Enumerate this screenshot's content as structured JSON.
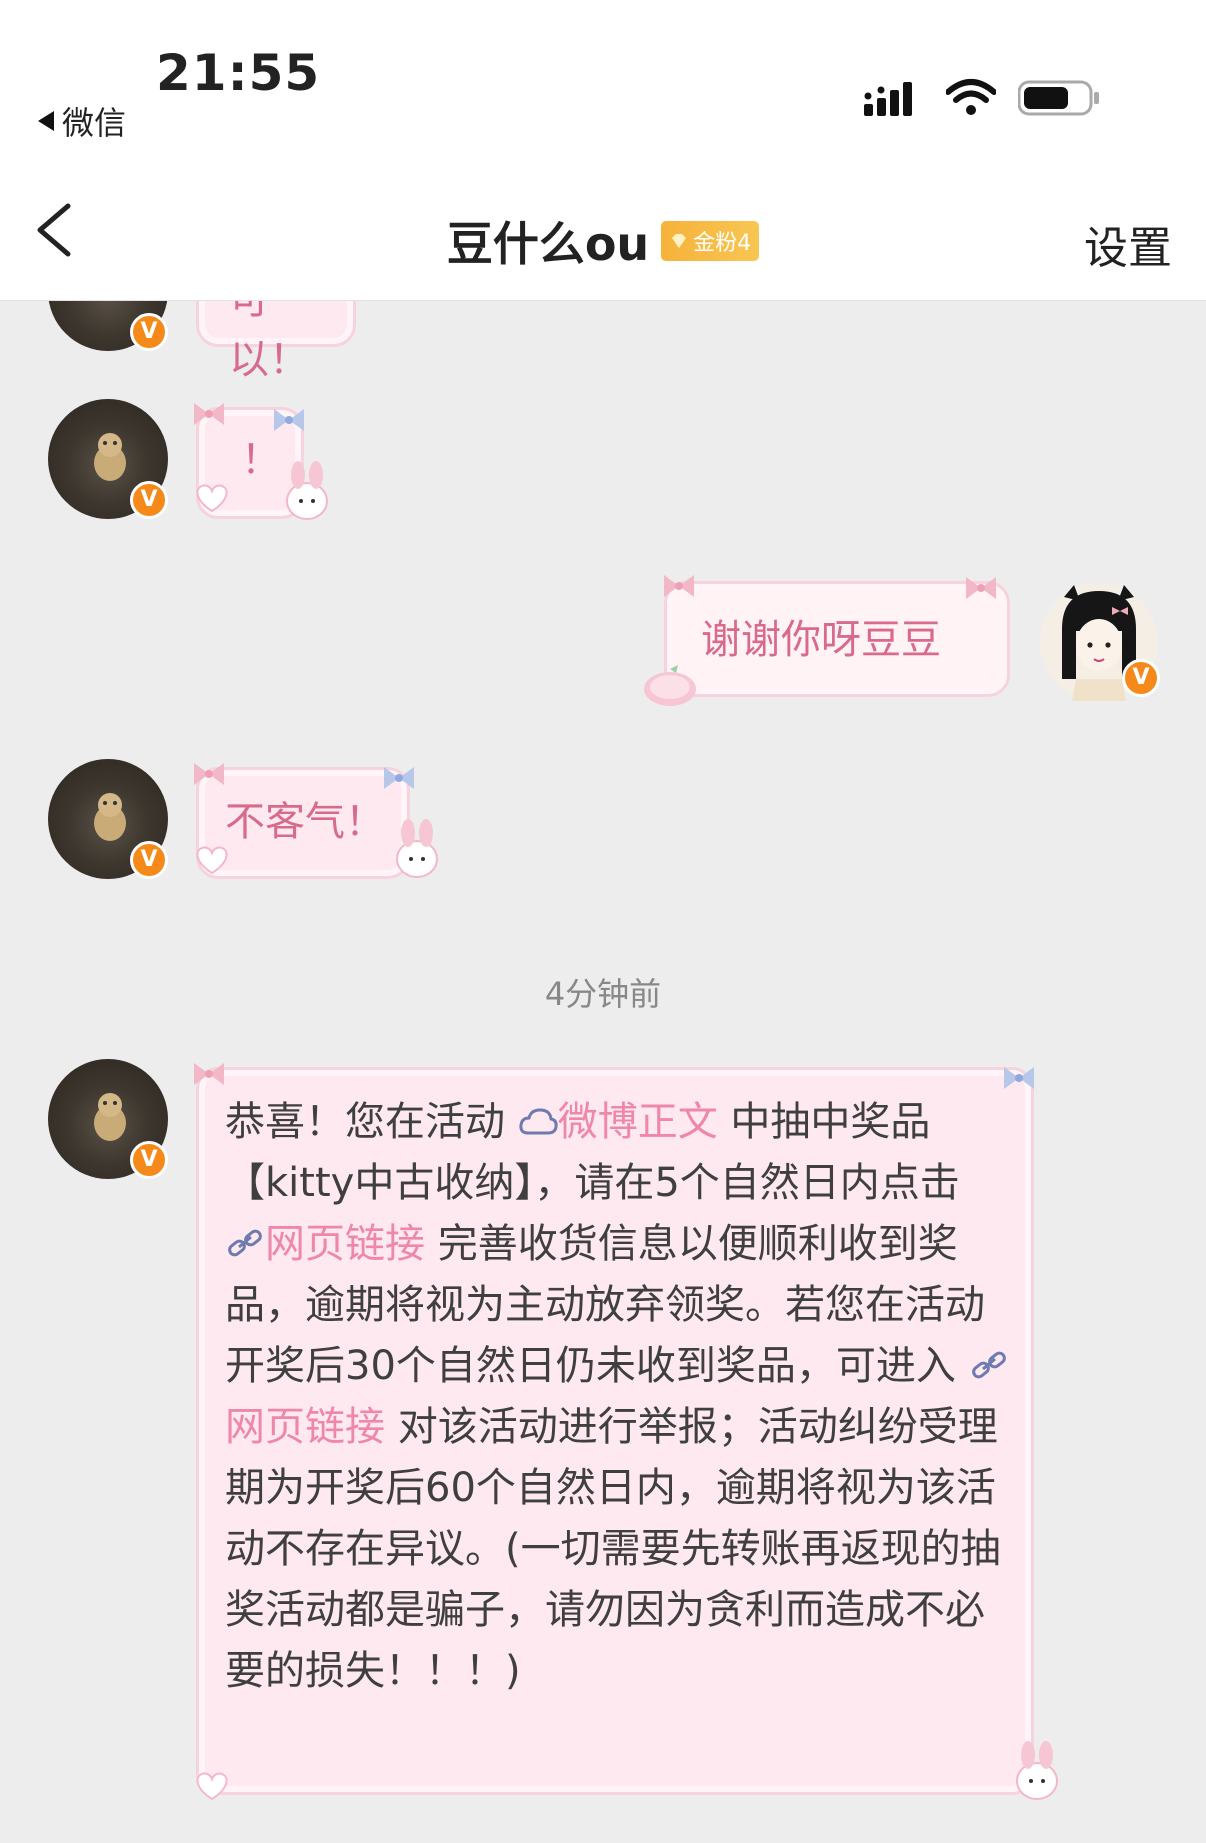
{
  "status_bar": {
    "time": "21:55",
    "back_app": "微信"
  },
  "nav": {
    "title": "豆什么ou",
    "fan_badge": "金粉4",
    "settings": "设置"
  },
  "messages": [
    {
      "side": "left",
      "text": "可以！"
    },
    {
      "side": "left",
      "text": "！"
    },
    {
      "side": "right",
      "text": "谢谢你呀豆豆"
    },
    {
      "side": "left",
      "text": "不客气！"
    }
  ],
  "timestamp": "4分钟前",
  "long_message": {
    "p1": "恭喜！您在活动 ",
    "link1": "微博正文",
    "p2": " 中抽中奖品【kitty中古收纳】，请在5个自然日内点击 ",
    "link2": "网页链接",
    "p3": " 完善收货信息以便顺利收到奖品，逾期将视为主动放弃领奖。若您在活动开奖后30个自然日仍未收到奖品，可进入 ",
    "link3": "网页链接",
    "p4": " 对该活动进行举报；活动纠纷受理期为开奖后60个自然日内，逾期将视为该活动不存在异议。(一切需要先转账再返现的抽奖活动都是骗子，请勿因为贪利而造成不必要的损失！！！)"
  },
  "colors": {
    "bubble_bg": "#fde9ef",
    "bubble_text": "#d86b8c",
    "link_pink": "#ee87ab",
    "badge_orange": "#f58a1a",
    "chat_bg": "#ededed"
  }
}
